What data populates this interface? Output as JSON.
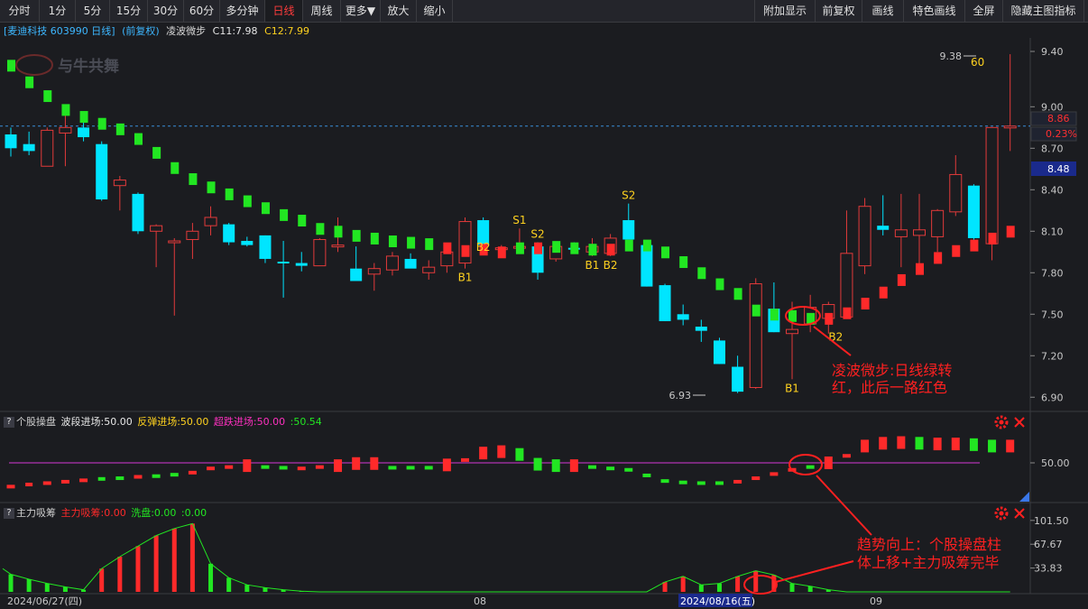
{
  "toolbar": {
    "left": [
      "分时",
      "1分",
      "5分",
      "15分",
      "30分",
      "60分",
      "多分钟",
      "日线",
      "周线",
      "更多▼",
      "放大",
      "缩小"
    ],
    "active": "日线",
    "right": [
      "附加显示",
      "前复权",
      "画线",
      "特色画线",
      "全屏",
      "隐藏主图指标"
    ]
  },
  "legend": {
    "stock": "[麦迪科技 603990 日线]",
    "adjust": "(前复权)",
    "indicator": "凌波微步",
    "c11": "C11:7.98",
    "c12": "C12:7.99"
  },
  "watermark": "与牛共舞",
  "price_axis": {
    "ticks": [
      "9.40",
      "9.00",
      "8.70",
      "8.40",
      "8.10",
      "7.80",
      "7.50",
      "7.20",
      "6.90"
    ],
    "current": "8.86",
    "change": "0.23%",
    "cursor": "8.48"
  },
  "main_annotations": {
    "high": "9.38",
    "high_num": "60",
    "low": "6.93",
    "note": "凌波微步:日线绿转红，此后一路红色"
  },
  "signals": [
    {
      "text": "B1",
      "c": 25,
      "side": "below"
    },
    {
      "text": "B2",
      "c": 26,
      "side": "below"
    },
    {
      "text": "S1",
      "c": 28,
      "side": "above"
    },
    {
      "text": "S2",
      "c": 29,
      "side": "above"
    },
    {
      "text": "B1",
      "c": 32,
      "side": "below"
    },
    {
      "text": "B2",
      "c": 33,
      "side": "below"
    },
    {
      "text": "S2",
      "c": 34,
      "side": "above"
    },
    {
      "text": "B1",
      "c": 43,
      "side": "below"
    },
    {
      "text": "B2",
      "c": 45,
      "side": "right"
    }
  ],
  "panel2": {
    "name": "个股操盘",
    "s1": "波段进场:50.00",
    "s2": "反弹进场:50.00",
    "s3": "超跌进场:50.00",
    "s4": ":50.54",
    "tick": "50.00"
  },
  "panel3": {
    "name": "主力吸筹",
    "s1": "主力吸筹:0.00",
    "s2": "洗盘:0.00",
    "s3": ":0.00",
    "ticks": [
      "101.50",
      "67.67",
      "33.83"
    ],
    "note": "趋势向上：个股操盘柱体上移+主力吸筹完毕"
  },
  "date_axis": [
    "2024/06/27(四)",
    "08",
    "2024/08/16(五)",
    "09"
  ],
  "colors": {
    "up": "#ff2a2a",
    "down": "#00e5ff",
    "green": "#22e622",
    "pink": "#ff30c0",
    "yellow": "#ffd21f",
    "annot": "#ff2020"
  },
  "chart_data": {
    "type": "candlestick",
    "ohlc": [
      [
        8.8,
        8.85,
        8.64,
        8.7
      ],
      [
        8.73,
        8.82,
        8.65,
        8.68
      ],
      [
        8.57,
        8.85,
        8.57,
        8.83
      ],
      [
        8.81,
        9.0,
        8.57,
        8.85
      ],
      [
        8.85,
        8.89,
        8.75,
        8.78
      ],
      [
        8.73,
        8.75,
        8.32,
        8.33
      ],
      [
        8.43,
        8.5,
        8.25,
        8.47
      ],
      [
        8.37,
        8.38,
        8.08,
        8.1
      ],
      [
        8.1,
        8.15,
        7.84,
        8.14
      ],
      [
        8.03,
        8.05,
        7.49,
        8.03
      ],
      [
        8.04,
        8.16,
        7.9,
        8.1
      ],
      [
        8.14,
        8.28,
        8.07,
        8.2
      ],
      [
        8.15,
        8.16,
        8.0,
        8.02
      ],
      [
        8.03,
        8.06,
        7.99,
        8.0
      ],
      [
        8.07,
        8.07,
        7.87,
        7.9
      ],
      [
        7.88,
        8.03,
        7.62,
        7.87
      ],
      [
        7.87,
        7.95,
        7.81,
        7.85
      ],
      [
        7.85,
        8.05,
        7.85,
        8.04
      ],
      [
        8.0,
        8.2,
        7.95,
        8.0
      ],
      [
        7.83,
        7.99,
        7.78,
        7.74
      ],
      [
        7.79,
        7.87,
        7.67,
        7.83
      ],
      [
        7.82,
        7.95,
        7.78,
        7.92
      ],
      [
        7.9,
        7.94,
        7.84,
        7.83
      ],
      [
        7.8,
        7.89,
        7.75,
        7.84
      ],
      [
        7.85,
        8.0,
        7.8,
        7.95
      ],
      [
        7.87,
        8.2,
        7.83,
        8.17
      ],
      [
        8.18,
        8.2,
        8.05,
        8.0
      ],
      [
        7.98,
        8.0,
        7.95,
        7.98
      ],
      [
        7.99,
        8.12,
        7.97,
        7.99
      ],
      [
        7.99,
        8.02,
        7.75,
        7.8
      ],
      [
        7.9,
        8.0,
        7.88,
        7.99
      ],
      [
        7.98,
        8.02,
        7.96,
        7.97
      ],
      [
        7.95,
        8.05,
        7.92,
        7.99
      ],
      [
        7.94,
        8.08,
        7.92,
        8.05
      ],
      [
        8.18,
        8.3,
        8.08,
        8.04
      ],
      [
        8.0,
        8.02,
        7.7,
        7.7
      ],
      [
        7.71,
        7.72,
        7.45,
        7.45
      ],
      [
        7.5,
        7.57,
        7.42,
        7.46
      ],
      [
        7.41,
        7.46,
        7.3,
        7.38
      ],
      [
        7.31,
        7.33,
        7.14,
        7.14
      ],
      [
        7.12,
        7.2,
        6.93,
        6.94
      ],
      [
        6.97,
        7.76,
        6.96,
        7.72
      ],
      [
        7.54,
        7.73,
        7.37,
        7.37
      ],
      [
        7.36,
        7.59,
        7.03,
        7.39
      ],
      [
        7.43,
        7.64,
        7.37,
        7.55
      ],
      [
        7.47,
        7.59,
        7.36,
        7.57
      ],
      [
        7.48,
        8.25,
        7.47,
        7.94
      ],
      [
        7.85,
        8.34,
        7.79,
        8.28
      ],
      [
        8.14,
        8.36,
        8.07,
        8.11
      ],
      [
        8.06,
        8.37,
        7.84,
        8.11
      ],
      [
        8.07,
        8.37,
        7.84,
        8.11
      ],
      [
        8.06,
        8.26,
        7.95,
        8.25
      ],
      [
        8.24,
        8.65,
        8.21,
        8.51
      ],
      [
        8.43,
        8.44,
        8.04,
        8.05
      ],
      [
        8.01,
        8.19,
        7.89,
        8.85
      ],
      [
        8.86,
        9.38,
        8.68,
        8.86
      ]
    ],
    "step": [
      [
        9.3,
        "green"
      ],
      [
        9.18,
        "green"
      ],
      [
        9.08,
        "green"
      ],
      [
        8.98,
        "green"
      ],
      [
        8.93,
        "green"
      ],
      [
        8.88,
        "green"
      ],
      [
        8.84,
        "green"
      ],
      [
        8.77,
        "green"
      ],
      [
        8.67,
        "green"
      ],
      [
        8.56,
        "green"
      ],
      [
        8.48,
        "green"
      ],
      [
        8.42,
        "green"
      ],
      [
        8.37,
        "green"
      ],
      [
        8.32,
        "green"
      ],
      [
        8.27,
        "green"
      ],
      [
        8.22,
        "green"
      ],
      [
        8.18,
        "green"
      ],
      [
        8.12,
        "green"
      ],
      [
        8.1,
        "green"
      ],
      [
        8.07,
        "green"
      ],
      [
        8.05,
        "green"
      ],
      [
        8.03,
        "green"
      ],
      [
        8.02,
        "green"
      ],
      [
        8.01,
        "green"
      ],
      [
        7.98,
        "red"
      ],
      [
        7.96,
        "red"
      ],
      [
        7.97,
        "red"
      ],
      [
        7.95,
        "red"
      ],
      [
        7.98,
        "green"
      ],
      [
        7.98,
        "red"
      ],
      [
        7.99,
        "green"
      ],
      [
        7.98,
        "green"
      ],
      [
        7.97,
        "green"
      ],
      [
        7.97,
        "red"
      ],
      [
        8.0,
        "green"
      ],
      [
        8.0,
        "green"
      ],
      [
        7.95,
        "green"
      ],
      [
        7.88,
        "green"
      ],
      [
        7.8,
        "green"
      ],
      [
        7.72,
        "green"
      ],
      [
        7.65,
        "green"
      ],
      [
        7.53,
        "green"
      ],
      [
        7.5,
        "green"
      ],
      [
        7.49,
        "green"
      ],
      [
        7.47,
        "green"
      ],
      [
        7.47,
        "red"
      ],
      [
        7.51,
        "red"
      ],
      [
        7.58,
        "red"
      ],
      [
        7.66,
        "red"
      ],
      [
        7.75,
        "red"
      ],
      [
        7.83,
        "red"
      ],
      [
        7.91,
        "red"
      ],
      [
        7.96,
        "red"
      ],
      [
        8.0,
        "red"
      ],
      [
        8.05,
        "red"
      ],
      [
        8.1,
        "red"
      ]
    ],
    "panel2_bars": [
      [
        33.0,
        "red"
      ],
      [
        34.5,
        "red"
      ],
      [
        35.5,
        "red"
      ],
      [
        36.5,
        "red"
      ],
      [
        37.5,
        "red"
      ],
      [
        38.5,
        "green"
      ],
      [
        39.0,
        "green"
      ],
      [
        40.0,
        "red"
      ],
      [
        40.5,
        "green"
      ],
      [
        41.5,
        "green"
      ],
      [
        43.0,
        "red"
      ],
      [
        46.0,
        "red"
      ],
      [
        47.0,
        "red"
      ],
      [
        48.0,
        "red"
      ],
      [
        47.0,
        "green"
      ],
      [
        46.5,
        "green"
      ],
      [
        46.0,
        "red"
      ],
      [
        47.0,
        "red"
      ],
      [
        48.0,
        "red"
      ],
      [
        49.5,
        "red"
      ],
      [
        49.5,
        "red"
      ],
      [
        46.5,
        "green"
      ],
      [
        46.5,
        "green"
      ],
      [
        46.5,
        "green"
      ],
      [
        48.5,
        "red"
      ],
      [
        52.0,
        "red"
      ],
      [
        57.0,
        "red"
      ],
      [
        58.0,
        "red"
      ],
      [
        56.0,
        "green"
      ],
      [
        49.0,
        "green"
      ],
      [
        48.0,
        "green"
      ],
      [
        48.0,
        "red"
      ],
      [
        47.0,
        "green"
      ],
      [
        46.0,
        "green"
      ],
      [
        45.0,
        "green"
      ],
      [
        41.0,
        "green"
      ],
      [
        37.0,
        "green"
      ],
      [
        36.0,
        "green"
      ],
      [
        35.5,
        "green"
      ],
      [
        35.5,
        "green"
      ],
      [
        36.5,
        "red"
      ],
      [
        39.0,
        "red"
      ],
      [
        42.0,
        "red"
      ],
      [
        45.0,
        "red"
      ],
      [
        47.0,
        "green"
      ],
      [
        50.0,
        "red"
      ],
      [
        55.0,
        "red"
      ],
      [
        62.0,
        "red"
      ],
      [
        64.0,
        "red"
      ],
      [
        64.5,
        "red"
      ],
      [
        64.0,
        "green"
      ],
      [
        63.5,
        "red"
      ],
      [
        63.5,
        "red"
      ],
      [
        63.0,
        "green"
      ],
      [
        62.0,
        "green"
      ],
      [
        62.0,
        "red"
      ]
    ],
    "panel3_bars": [
      [
        25,
        "green"
      ],
      [
        18,
        "green"
      ],
      [
        12,
        "green"
      ],
      [
        7,
        "green"
      ],
      [
        3,
        "green"
      ],
      [
        33,
        "red"
      ],
      [
        50,
        "red"
      ],
      [
        65,
        "red"
      ],
      [
        80,
        "red"
      ],
      [
        90,
        "red"
      ],
      [
        97,
        "red"
      ],
      [
        40,
        "green"
      ],
      [
        20,
        "green"
      ],
      [
        10,
        "green"
      ],
      [
        6,
        "green"
      ],
      [
        3,
        "green"
      ],
      [
        1,
        "green"
      ],
      [
        0,
        "green"
      ],
      [
        0,
        "green"
      ],
      [
        0,
        "green"
      ],
      [
        0,
        "green"
      ],
      [
        0,
        "green"
      ],
      [
        0,
        "green"
      ],
      [
        0,
        "green"
      ],
      [
        0,
        "green"
      ],
      [
        0,
        "green"
      ],
      [
        0,
        "green"
      ],
      [
        0,
        "green"
      ],
      [
        0,
        "green"
      ],
      [
        0,
        "green"
      ],
      [
        0,
        "green"
      ],
      [
        0,
        "green"
      ],
      [
        0,
        "green"
      ],
      [
        0,
        "green"
      ],
      [
        0,
        "green"
      ],
      [
        0,
        "green"
      ],
      [
        14,
        "red"
      ],
      [
        22,
        "red"
      ],
      [
        10,
        "green"
      ],
      [
        12,
        "green"
      ],
      [
        22,
        "red"
      ],
      [
        30,
        "red"
      ],
      [
        24,
        "red"
      ],
      [
        12,
        "green"
      ],
      [
        8,
        "green"
      ],
      [
        3,
        "green"
      ],
      [
        0,
        "green"
      ],
      [
        0,
        "green"
      ],
      [
        0,
        "green"
      ],
      [
        0,
        "green"
      ],
      [
        0,
        "green"
      ],
      [
        0,
        "green"
      ],
      [
        0,
        "green"
      ],
      [
        0,
        "green"
      ],
      [
        0,
        "green"
      ],
      [
        0,
        "green"
      ]
    ]
  }
}
